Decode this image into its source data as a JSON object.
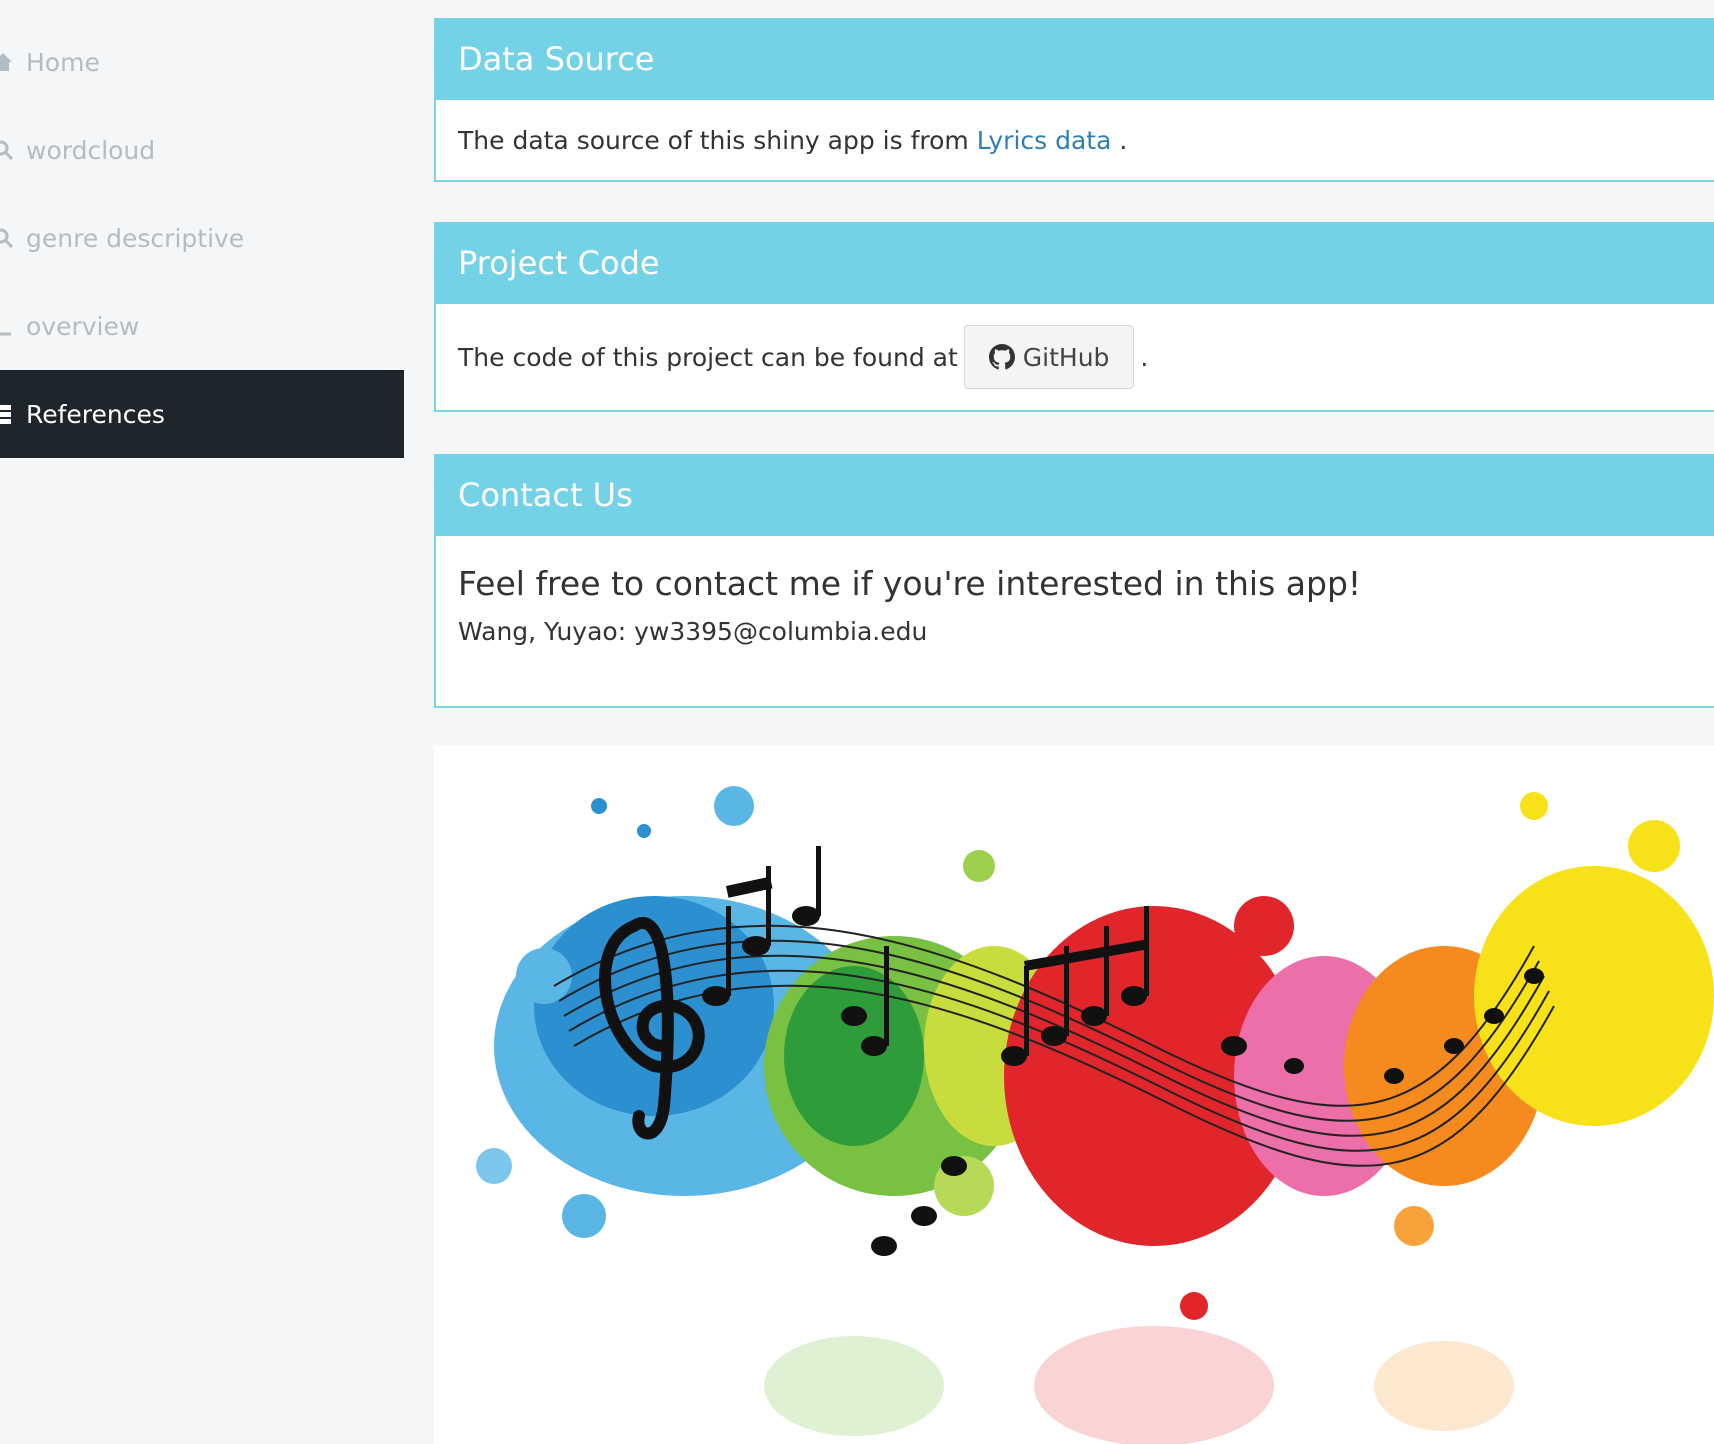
{
  "sidebar": {
    "items": [
      {
        "label": "Home",
        "icon": "home-icon"
      },
      {
        "label": "wordcloud",
        "icon": "search-icon"
      },
      {
        "label": "genre descriptive",
        "icon": "search-icon"
      },
      {
        "label": "overview",
        "icon": "chart-icon"
      },
      {
        "label": "References",
        "icon": "list-icon",
        "active": true
      }
    ]
  },
  "data_source": {
    "title": "Data Source",
    "text_before": "The data source of this shiny app is from",
    "link_label": "Lyrics data",
    "text_after": "."
  },
  "project_code": {
    "title": "Project Code",
    "text_before": "The code of this project can be found at",
    "button_label": "GitHub",
    "text_after": "."
  },
  "contact": {
    "title": "Contact Us",
    "heading": "Feel free to contact me if you're interested in this app!",
    "line": "Wang, Yuyao: yw3395@columbia.edu"
  },
  "colors": {
    "box_header": "#74d2e6",
    "sidebar_active": "#1f262b",
    "link": "#2f7fb5"
  }
}
